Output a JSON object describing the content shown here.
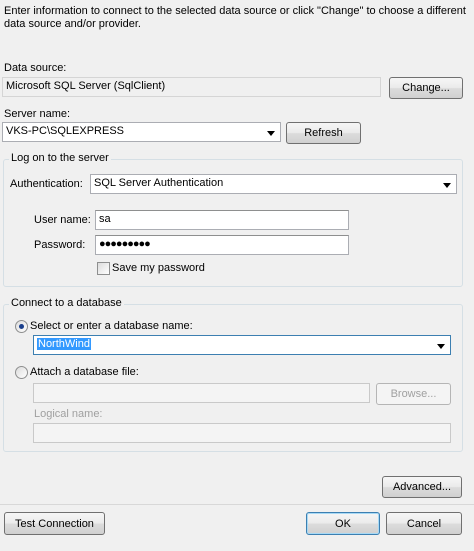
{
  "intro": {
    "line1": "Enter information to connect to the selected data source or click \"Change\" to choose a different",
    "line2": "data source and/or provider."
  },
  "data_source": {
    "label": "Data source:",
    "value": "Microsoft SQL Server (SqlClient)",
    "change_button": "Change..."
  },
  "server": {
    "label": "Server name:",
    "value": "VKS-PC\\SQLEXPRESS",
    "refresh_button": "Refresh"
  },
  "logon": {
    "title": "Log on to the server",
    "authentication_label": "Authentication:",
    "authentication_value": "SQL Server Authentication",
    "username_label": "User name:",
    "username_value": "sa",
    "password_label": "Password:",
    "password_value": "●●●●●●●●●",
    "save_password_label": "Save my password",
    "save_password_checked": false
  },
  "database": {
    "title": "Connect to a database",
    "select_label": "Select or enter a database name:",
    "select_value": "NorthWind",
    "attach_label": "Attach a database file:",
    "attach_value": "",
    "browse_button": "Browse...",
    "logical_name_label": "Logical name:",
    "logical_name_value": ""
  },
  "footer": {
    "advanced_button": "Advanced...",
    "test_button": "Test Connection",
    "ok_button": "OK",
    "cancel_button": "Cancel"
  }
}
